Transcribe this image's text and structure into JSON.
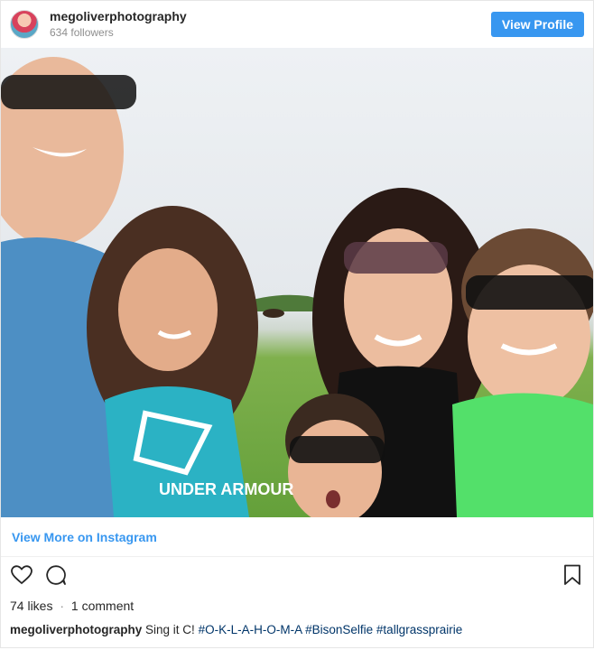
{
  "header": {
    "username": "megoliverphotography",
    "followers": "634 followers",
    "view_profile_label": "View Profile"
  },
  "photo": {
    "description_icon": "family-selfie-photo",
    "shirt_text": "UNDER ARMOUR"
  },
  "footer": {
    "view_more_label": "View More on Instagram",
    "likes": "74 likes",
    "separator": "·",
    "comments": "1 comment",
    "caption_username": "megoliverphotography",
    "caption_text": "Sing it C!",
    "hashtags": [
      "#O-K-L-A-H-O-M-A",
      "#BisonSelfie",
      "#tallgrassprairie"
    ]
  },
  "colors": {
    "accent": "#3897f0",
    "text": "#262626",
    "muted": "#8e8e8e",
    "hashtag": "#003569"
  },
  "icons": [
    "heart-icon",
    "comment-icon",
    "bookmark-icon"
  ]
}
